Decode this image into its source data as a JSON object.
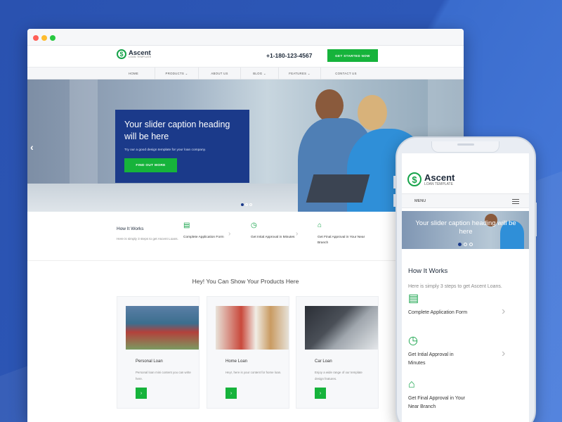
{
  "site": {
    "brand": "Ascent",
    "brand_sub": "LOAN TEMPLATE",
    "phone": "+1-180-123-4567",
    "cta": "GET STARTED NOW",
    "nav": [
      "HOME",
      "PRODUCTS ⌄",
      "ABOUT US",
      "BLOG ⌄",
      "FEATURES ⌄",
      "CONTACT US"
    ]
  },
  "hero": {
    "heading": "Your slider caption heading will be here",
    "text": "Try our a good design template for your loan company.",
    "button": "FIND OUT MORE",
    "prev_icon": "chevron-left-icon"
  },
  "how": {
    "title": "How It Works",
    "subtitle": "Here is simply 3 steps to get Ascent Loans.",
    "steps": [
      {
        "icon": "clipboard-icon",
        "label": "Complete Application Form"
      },
      {
        "icon": "clock-icon",
        "label": "Get Intial Approval in Minutes"
      },
      {
        "icon": "bank-icon",
        "label": "Get Final Approval in Your Near Branch"
      }
    ]
  },
  "products": {
    "title": "Hey! You Can Show Your Products Here",
    "cards": [
      {
        "title": "Personal Loan",
        "text": "Personal loan mini content you can write here."
      },
      {
        "title": "Home Loan",
        "text": "Hey!, here is your content for home loan."
      },
      {
        "title": "Car Loan",
        "text": "Enjoy a wide range of our template design features."
      }
    ]
  },
  "mobile": {
    "brand": "Ascent",
    "brand_sub": "LOAN TEMPLATE",
    "menu": "MENU",
    "hero_caption": "Your slider caption heading will be here",
    "how_title": "How It Works",
    "how_subtitle": "Here is simply 3 steps to get Ascent Loans.",
    "steps": [
      {
        "label": "Complete Application Form"
      },
      {
        "label": "Get Intial Approval in Minutes"
      },
      {
        "label": "Get Final Approval in Your Near Branch"
      }
    ]
  },
  "colors": {
    "accent": "#16b33b",
    "brand_blue": "#1b3a8a",
    "background": "#2b55b3"
  }
}
